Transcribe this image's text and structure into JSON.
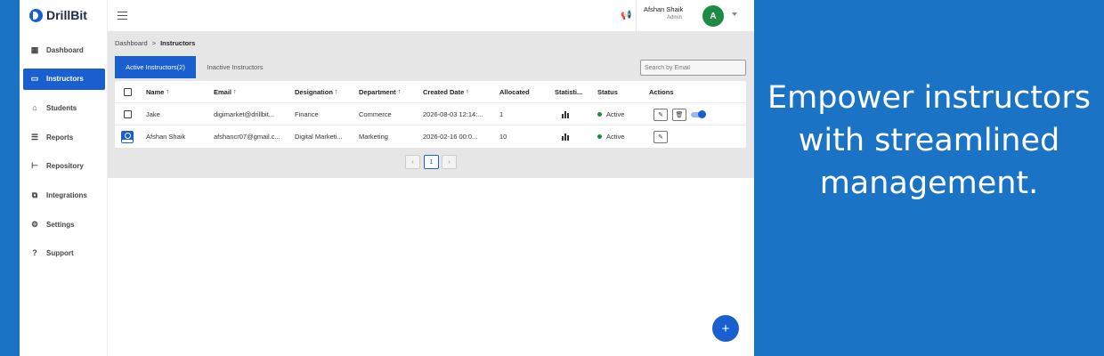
{
  "brand": {
    "name": "DrillBit",
    "color": "#1a5fd0"
  },
  "sidebar": {
    "items": [
      {
        "label": "Dashboard",
        "icon": "dashboard-icon"
      },
      {
        "label": "Instructors",
        "icon": "instructors-icon",
        "active": true
      },
      {
        "label": "Students",
        "icon": "students-icon"
      },
      {
        "label": "Reports",
        "icon": "reports-icon"
      },
      {
        "label": "Repository",
        "icon": "repository-icon"
      },
      {
        "label": "Integrations",
        "icon": "integrations-icon"
      },
      {
        "label": "Settings",
        "icon": "settings-icon"
      },
      {
        "label": "Support",
        "icon": "support-icon"
      }
    ]
  },
  "topbar": {
    "user_name": "Afshan Shaik",
    "user_role": "Admin",
    "avatar_letter": "A"
  },
  "breadcrumb": {
    "parent": "Dashboard",
    "separator": ">",
    "current": "Instructors"
  },
  "tabs": {
    "active": "Active Instructors(2)",
    "inactive": "Inactive Instructors"
  },
  "search": {
    "placeholder": "Search by Email"
  },
  "table": {
    "headers": [
      "Name",
      "Email",
      "Designation",
      "Department",
      "Created Date",
      "Allocated",
      "Statisti...",
      "Status",
      "Actions"
    ],
    "rows": [
      {
        "name": "Jake",
        "email": "digimarket@drillbit...",
        "designation": "Finance",
        "department": "Commerce",
        "created": "2026-08-03 12:14:...",
        "allocated": "1",
        "status": "Active"
      },
      {
        "name": "Afshan Shaik",
        "email": "afshancr07@gmail.c...",
        "designation": "Digital Marketi...",
        "department": "Marketing",
        "created": "2026-02-16 00:0...",
        "allocated": "10",
        "status": "Active"
      }
    ]
  },
  "pagination": {
    "prev": "‹",
    "current": "1",
    "next": "›"
  },
  "fab": {
    "label": "+"
  },
  "promo": {
    "line1": "Empower instructors",
    "line2": "with streamlined",
    "line3": "management."
  },
  "colors": {
    "background": "#1a73c4",
    "active_status": "#1e8a44",
    "avatar": "#1e8a44"
  }
}
